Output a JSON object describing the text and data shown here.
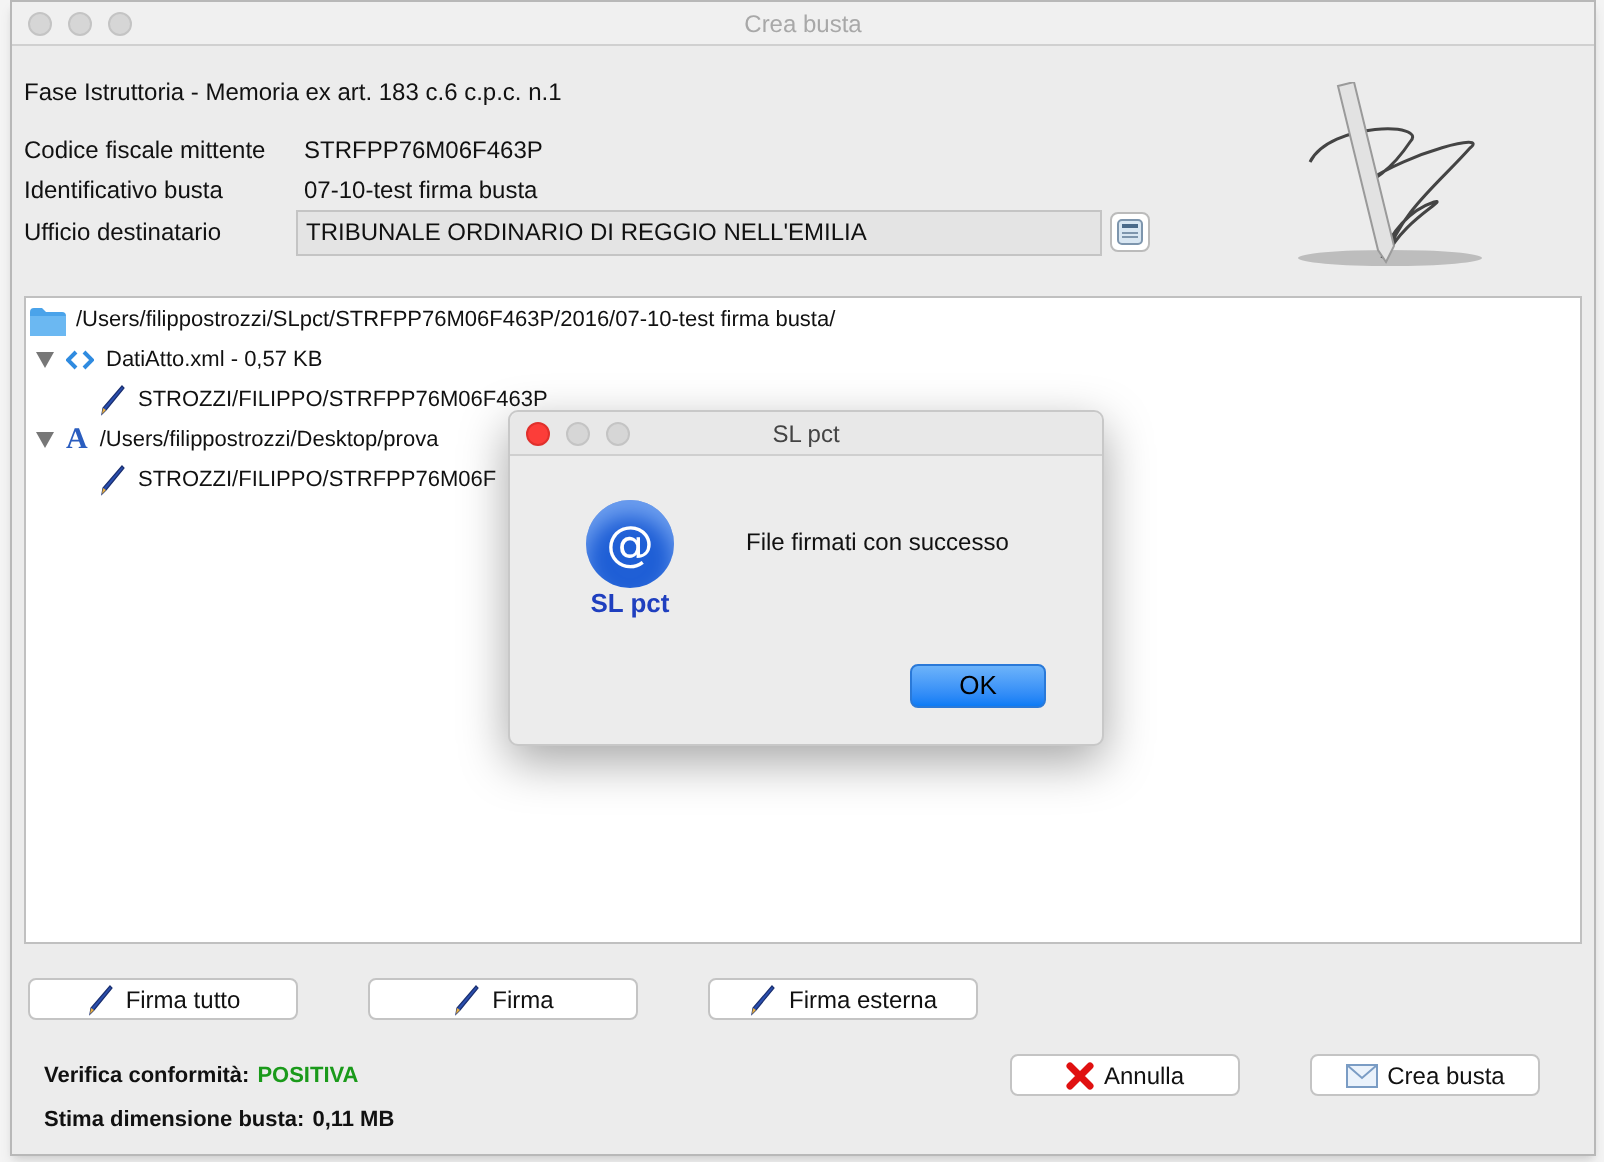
{
  "window": {
    "title": "Crea busta"
  },
  "heading": "Fase Istruttoria - Memoria ex art. 183 c.6 c.p.c. n.1",
  "fields": [
    {
      "label": "Codice fiscale mittente",
      "value": "STRFPP76M06F463P",
      "kind": "text"
    },
    {
      "label": "Identificativo busta",
      "value": "07-10-test firma busta",
      "kind": "text"
    },
    {
      "label": "Ufficio destinatario",
      "value": "TRIBUNALE ORDINARIO DI REGGIO NELL'EMILIA",
      "kind": "box"
    }
  ],
  "tree": {
    "label": "/Users/filippostrozzi/SLpct/STRFPP76M06F463P/2016/07-10-test firma busta/",
    "kind": "folder",
    "children": [
      {
        "label": "DatiAtto.xml - 0,57 KB",
        "kind": "xml",
        "expanded": true,
        "children": [
          {
            "label": "STROZZI/FILIPPO/STRFPP76M06F463P",
            "kind": "signature"
          }
        ]
      },
      {
        "label": "/Users/filippostrozzi/Desktop/prova",
        "kind": "document",
        "icon": "A",
        "expanded": true,
        "children": [
          {
            "label": "STROZZI/FILIPPO/STRFPP76M06F",
            "kind": "signature"
          }
        ]
      }
    ]
  },
  "sign_buttons": [
    "Firma tutto",
    "Firma",
    "Firma esterna"
  ],
  "status": [
    {
      "label": "Verifica conformità:",
      "value": "POSITIVA"
    },
    {
      "label": "Stima dimensione busta:",
      "value": "0,11 MB"
    }
  ],
  "actions": [
    {
      "label": "Annulla",
      "kind": "cancel"
    },
    {
      "label": "Crea busta",
      "kind": "envelope"
    }
  ],
  "dialog": {
    "title": "SL pct",
    "logo_symbol": "@",
    "logo_text": "SL pct",
    "message": "File firmati con successo",
    "button": "OK"
  }
}
